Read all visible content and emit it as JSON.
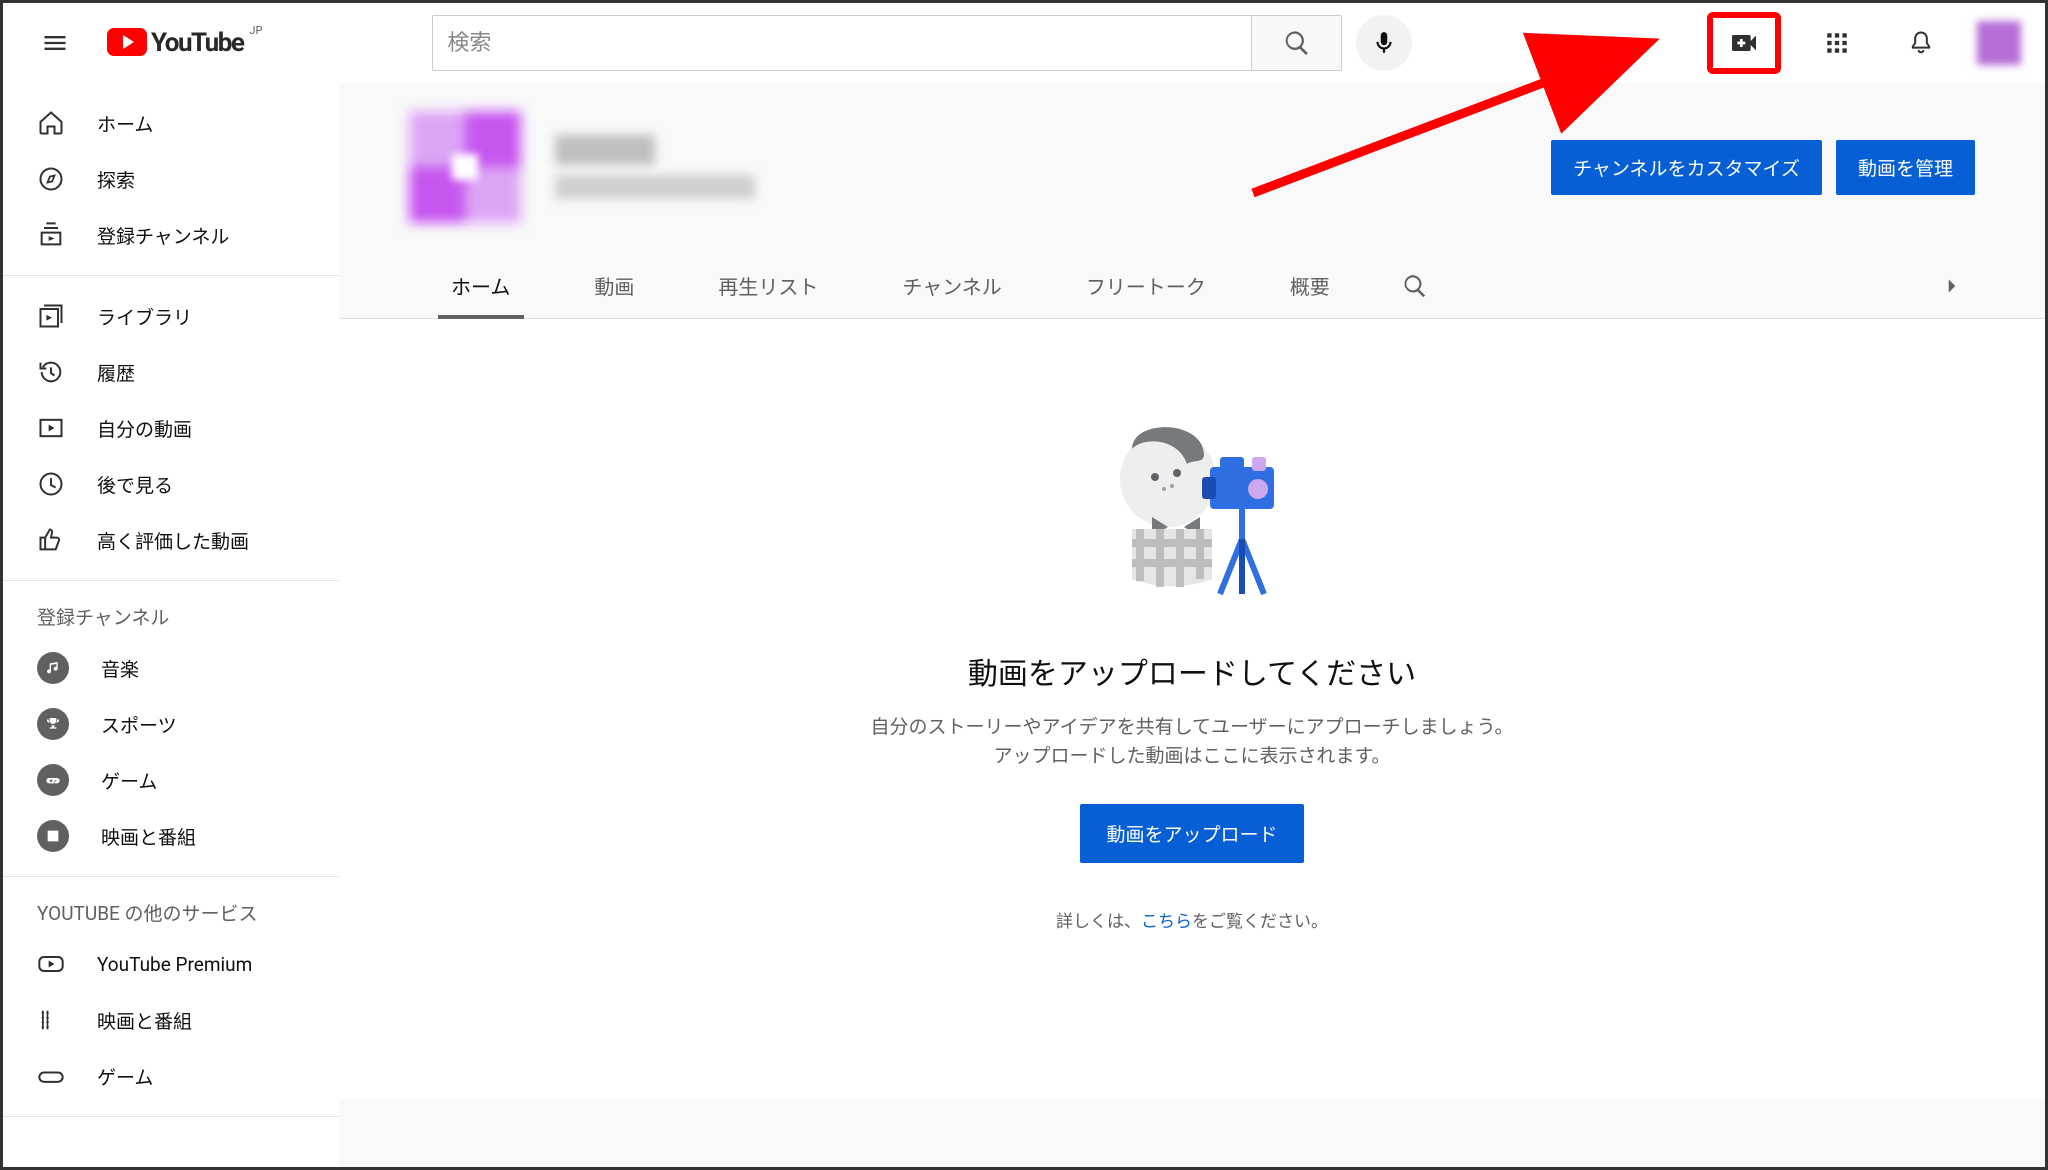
{
  "header": {
    "logo_text": "YouTube",
    "country": "JP",
    "search_placeholder": "検索"
  },
  "sidebar": {
    "primary": [
      {
        "label": "ホーム"
      },
      {
        "label": "探索"
      },
      {
        "label": "登録チャンネル"
      }
    ],
    "library": [
      {
        "label": "ライブラリ"
      },
      {
        "label": "履歴"
      },
      {
        "label": "自分の動画"
      },
      {
        "label": "後で見る"
      },
      {
        "label": "高く評価した動画"
      }
    ],
    "subs_header": "登録チャンネル",
    "subs": [
      {
        "label": "音楽"
      },
      {
        "label": "スポーツ"
      },
      {
        "label": "ゲーム"
      },
      {
        "label": "映画と番組"
      }
    ],
    "more_header": "YOUTUBE の他のサービス",
    "more": [
      {
        "label": "YouTube Premium"
      },
      {
        "label": "映画と番組"
      },
      {
        "label": "ゲーム"
      }
    ]
  },
  "channel": {
    "btn_customize": "チャンネルをカスタマイズ",
    "btn_manage": "動画を管理",
    "tabs": [
      "ホーム",
      "動画",
      "再生リスト",
      "チャンネル",
      "フリートーク",
      "概要"
    ],
    "active_tab": 0
  },
  "empty": {
    "title": "動画をアップロードしてください",
    "line1": "自分のストーリーやアイデアを共有してユーザーにアプローチしましょう。",
    "line2": "アップロードした動画はここに表示されます。",
    "button": "動画をアップロード",
    "more_pre": "詳しくは、",
    "more_link": "こちら",
    "more_post": "をご覧ください。"
  }
}
